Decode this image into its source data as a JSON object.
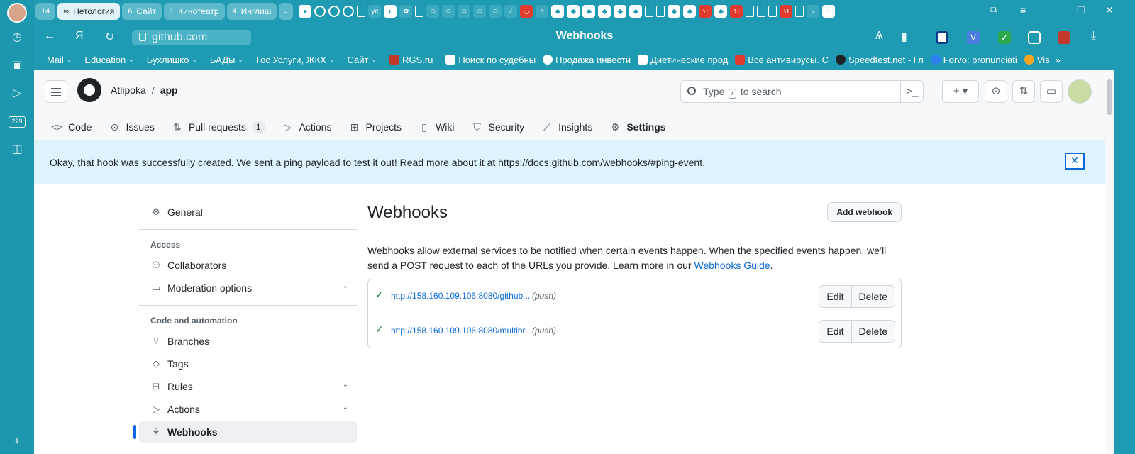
{
  "browser": {
    "tabs": [
      {
        "count": "14",
        "label": ""
      },
      {
        "count": "∞",
        "label": "Нетология",
        "active": true
      },
      {
        "count": "6",
        "label": "Сайт"
      },
      {
        "count": "1",
        "label": "Кинотеатр"
      },
      {
        "count": "4",
        "label": "Инглиш"
      }
    ],
    "url": "github.com",
    "page_title": "Webhooks",
    "rail_badge": "229",
    "bookmarks": [
      {
        "label": "Mail",
        "folder": true
      },
      {
        "label": "Education",
        "folder": true
      },
      {
        "label": "Бухлишко",
        "folder": true
      },
      {
        "label": "БАДы",
        "folder": true
      },
      {
        "label": "Гос Услуги, ЖКХ",
        "folder": true
      },
      {
        "label": "Сайт",
        "folder": true
      },
      {
        "label": "RGS.ru",
        "folder": false
      },
      {
        "label": "Поиск по судебны",
        "folder": false
      },
      {
        "label": "Продажа инвести",
        "folder": false
      },
      {
        "label": "Диетические прод",
        "folder": false
      },
      {
        "label": "Все антивирусы. С",
        "folder": false
      },
      {
        "label": "Speedtest.net - Гл",
        "folder": false
      },
      {
        "label": "Forvo: pronunciati",
        "folder": false
      },
      {
        "label": "Vis",
        "folder": false
      }
    ]
  },
  "github": {
    "owner": "Atlipoka",
    "repo": "app",
    "search_placeholder_before": "Type",
    "search_key": "/",
    "search_placeholder_after": "to search",
    "nav": [
      {
        "label": "Code",
        "icon": "code-icon"
      },
      {
        "label": "Issues",
        "icon": "issue-icon"
      },
      {
        "label": "Pull requests",
        "icon": "pull-request-icon",
        "count": "1"
      },
      {
        "label": "Actions",
        "icon": "play-icon"
      },
      {
        "label": "Projects",
        "icon": "table-icon"
      },
      {
        "label": "Wiki",
        "icon": "book-icon"
      },
      {
        "label": "Security",
        "icon": "shield-icon"
      },
      {
        "label": "Insights",
        "icon": "graph-icon"
      },
      {
        "label": "Settings",
        "icon": "gear-icon",
        "selected": true
      }
    ],
    "flash": "Okay, that hook was successfully created. We sent a ping payload to test it out! Read more about it at https://docs.github.com/webhooks/#ping-event.",
    "sidebar": {
      "general": "General",
      "access_heading": "Access",
      "collaborators": "Collaborators",
      "moderation": "Moderation options",
      "code_heading": "Code and automation",
      "branches": "Branches",
      "tags": "Tags",
      "rules": "Rules",
      "actions": "Actions",
      "webhooks": "Webhooks"
    },
    "main": {
      "title": "Webhooks",
      "add_button": "Add webhook",
      "description": "Webhooks allow external services to be notified when certain events happen. When the specified events happen, we’ll send a POST request to each of the URLs you provide. Learn more in our",
      "guide_link": "Webhooks Guide",
      "description_end": ".",
      "hooks": [
        {
          "url": "http://158.160.109.106:8080/github...",
          "event": "(push)",
          "edit": "Edit",
          "delete": "Delete"
        },
        {
          "url": "http://158.160.109.106:8080/multibr...",
          "event": "(push)",
          "edit": "Edit",
          "delete": "Delete"
        }
      ]
    }
  },
  "colors": {
    "browser_accent": "#1e9bb3",
    "link": "#0969da",
    "success": "#1a7f37",
    "selected_underline": "#fd8c73",
    "flash_bg": "#ddf4ff"
  }
}
